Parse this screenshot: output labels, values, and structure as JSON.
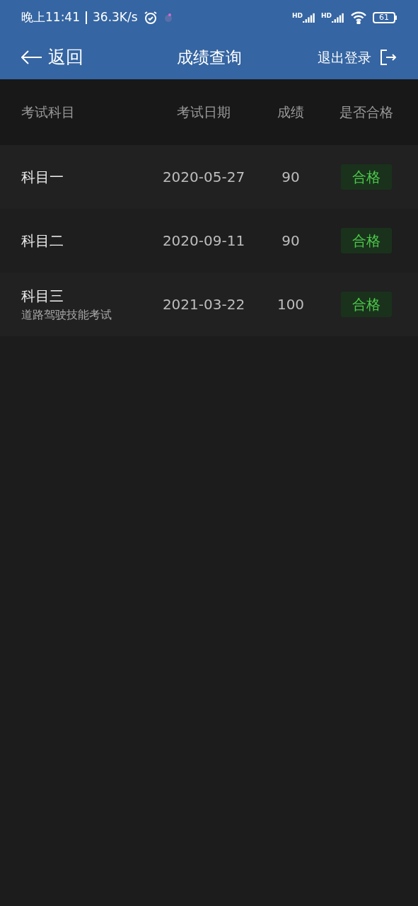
{
  "status_bar": {
    "time": "晚上11:41",
    "speed": "36.3K/s",
    "signal_labels": [
      "HD",
      "HD"
    ],
    "battery": "61"
  },
  "nav": {
    "back": "返回",
    "title": "成绩查询",
    "logout": "退出登录"
  },
  "table": {
    "columns": [
      "考试科目",
      "考试日期",
      "成绩",
      "是否合格"
    ],
    "rows": [
      {
        "subject": "科目一",
        "date": "2020-05-27",
        "score": "90",
        "result": "合格",
        "passed": true
      },
      {
        "subject": "科目二",
        "date": "2020-09-11",
        "score": "90",
        "result": "合格",
        "passed": true
      },
      {
        "subject": "科目三",
        "subtitle": "道路驾驶技能考试",
        "date": "2021-03-22",
        "score": "100",
        "result": "合格",
        "passed": true
      }
    ]
  }
}
